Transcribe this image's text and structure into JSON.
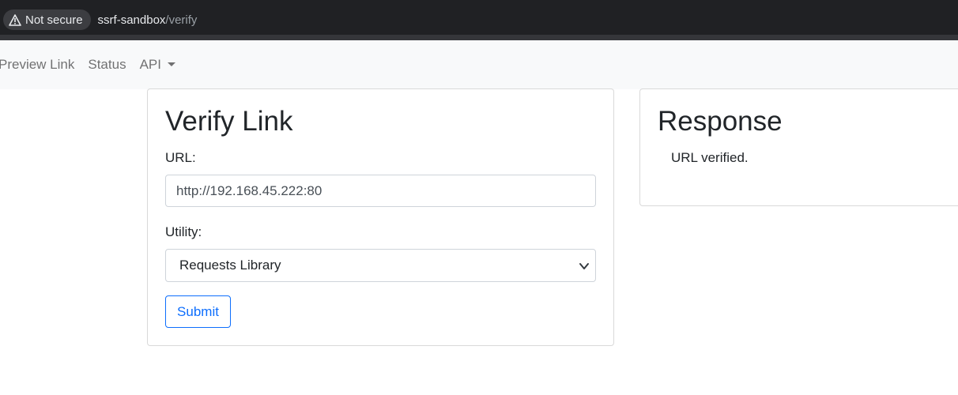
{
  "browser": {
    "security_label": "Not secure",
    "url_host": "ssrf-sandbox",
    "url_path": "/verify"
  },
  "navbar": {
    "links": [
      {
        "label": "Preview Link"
      },
      {
        "label": "Status"
      },
      {
        "label": "API"
      }
    ]
  },
  "verify_card": {
    "title": "Verify Link",
    "url_label": "URL:",
    "url_value": "http://192.168.45.222:80",
    "utility_label": "Utility:",
    "utility_selected": "Requests Library",
    "submit_label": "Submit"
  },
  "response_card": {
    "title": "Response",
    "message": "URL verified."
  },
  "colors": {
    "primary": "#0d6efd",
    "navbar_bg": "#f8f9fa",
    "browser_bg": "#202124"
  }
}
